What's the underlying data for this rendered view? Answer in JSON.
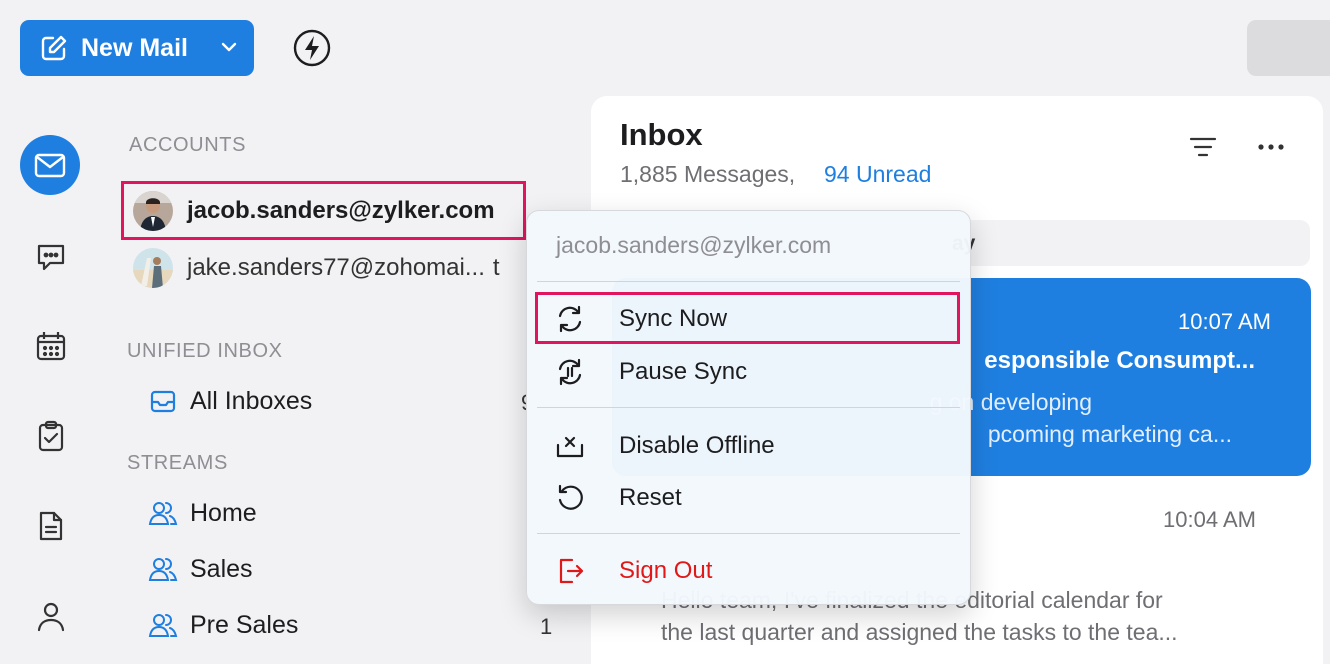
{
  "toolbar": {
    "new_mail_label": "New Mail"
  },
  "sidebar": {
    "accounts_heading": "ACCOUNTS",
    "accounts": [
      {
        "email": "jacob.sanders@zylker.com"
      },
      {
        "email": "jake.sanders77@zohomai...",
        "truncated_tail": "t"
      }
    ],
    "unified_heading": "UNIFIED INBOX",
    "all_inboxes_label": "All Inboxes",
    "all_inboxes_count": "9",
    "streams_heading": "STREAMS",
    "streams": [
      {
        "label": "Home",
        "count": ""
      },
      {
        "label": "Sales",
        "count": ""
      },
      {
        "label": "Pre Sales",
        "count": "1"
      }
    ]
  },
  "inbox": {
    "title": "Inbox",
    "messages": "1,885 Messages,",
    "unread": "94 Unread",
    "group_label": "ay",
    "selected_mail": {
      "time": "10:07 AM",
      "subject": "esponsible Consumpt...",
      "preview_line1": "g on developing",
      "preview_line2": "pcoming marketing ca..."
    },
    "second_mail": {
      "time": "10:04 AM",
      "preview_line1": "Hello team, I've finalized the editorial calendar for",
      "preview_line2": "the last quarter and assigned the tasks to the tea..."
    }
  },
  "context_menu": {
    "account": "jacob.sanders@zylker.com",
    "items": [
      {
        "label": "Sync Now",
        "icon": "sync-icon"
      },
      {
        "label": "Pause Sync",
        "icon": "pause-sync-icon"
      },
      {
        "label": "Disable Offline",
        "icon": "disable-offline-icon"
      },
      {
        "label": "Reset",
        "icon": "reset-icon"
      },
      {
        "label": "Sign Out",
        "icon": "sign-out-icon"
      }
    ]
  },
  "colors": {
    "accent": "#1f7fe0",
    "highlight": "#e0155e",
    "danger": "#e11818"
  }
}
